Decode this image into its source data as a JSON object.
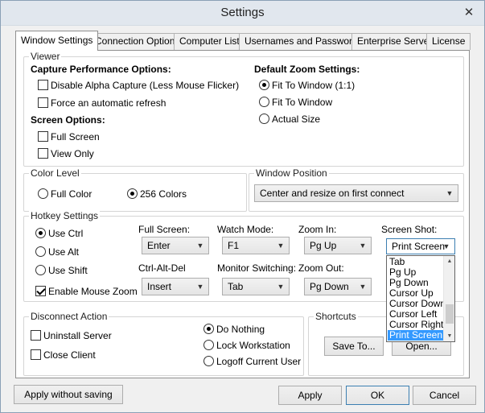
{
  "window": {
    "title": "Settings",
    "close_glyph": "✕"
  },
  "tabs": [
    "Window Settings",
    "Connection Options",
    "Computer Lists",
    "Usernames and Passwords",
    "Enterprise Server",
    "License"
  ],
  "viewer": {
    "label": "Viewer",
    "capture_heading": "Capture Performance Options:",
    "disable_alpha": "Disable Alpha Capture (Less Mouse Flicker)",
    "force_refresh": "Force an automatic refresh",
    "screen_heading": "Screen Options:",
    "full_screen": "Full Screen",
    "view_only": "View Only",
    "zoom_heading": "Default Zoom Settings:",
    "fit_1_1": "Fit To Window (1:1)",
    "fit_window": "Fit To Window",
    "actual_size": "Actual Size"
  },
  "color_level": {
    "label": "Color Level",
    "full_color": "Full Color",
    "colors_256": "256 Colors"
  },
  "window_position": {
    "label": "Window Position",
    "value": "Center and resize on first connect"
  },
  "hotkeys": {
    "label": "Hotkey Settings",
    "use_ctrl": "Use Ctrl",
    "use_alt": "Use Alt",
    "use_shift": "Use Shift",
    "enable_mouse_zoom": "Enable Mouse Zoom",
    "full_screen_label": "Full Screen:",
    "full_screen_value": "Enter",
    "watch_mode_label": "Watch Mode:",
    "watch_mode_value": "F1",
    "zoom_in_label": "Zoom In:",
    "zoom_in_value": "Pg Up",
    "screen_shot_label": "Screen Shot:",
    "screen_shot_value": "Print Screen",
    "ctrl_alt_del_label": "Ctrl-Alt-Del",
    "ctrl_alt_del_value": "Insert",
    "monitor_switching_label": "Monitor Switching:",
    "monitor_switching_value": "Tab",
    "zoom_out_label": "Zoom Out:",
    "zoom_out_value": "Pg Down",
    "dropdown_options": [
      "Tab",
      "Pg Up",
      "Pg Down",
      "Cursor Up",
      "Cursor Down",
      "Cursor Left",
      "Cursor Right",
      "Print Screen"
    ]
  },
  "disconnect": {
    "label": "Disconnect Action",
    "uninstall_server": "Uninstall Server",
    "close_client": "Close Client",
    "do_nothing": "Do Nothing",
    "lock_workstation": "Lock Workstation",
    "logoff_user": "Logoff Current User"
  },
  "shortcuts": {
    "label": "Shortcuts",
    "save_to": "Save To...",
    "open": "Open..."
  },
  "footer": {
    "apply_without_saving": "Apply without saving",
    "apply": "Apply",
    "ok": "OK",
    "cancel": "Cancel"
  }
}
